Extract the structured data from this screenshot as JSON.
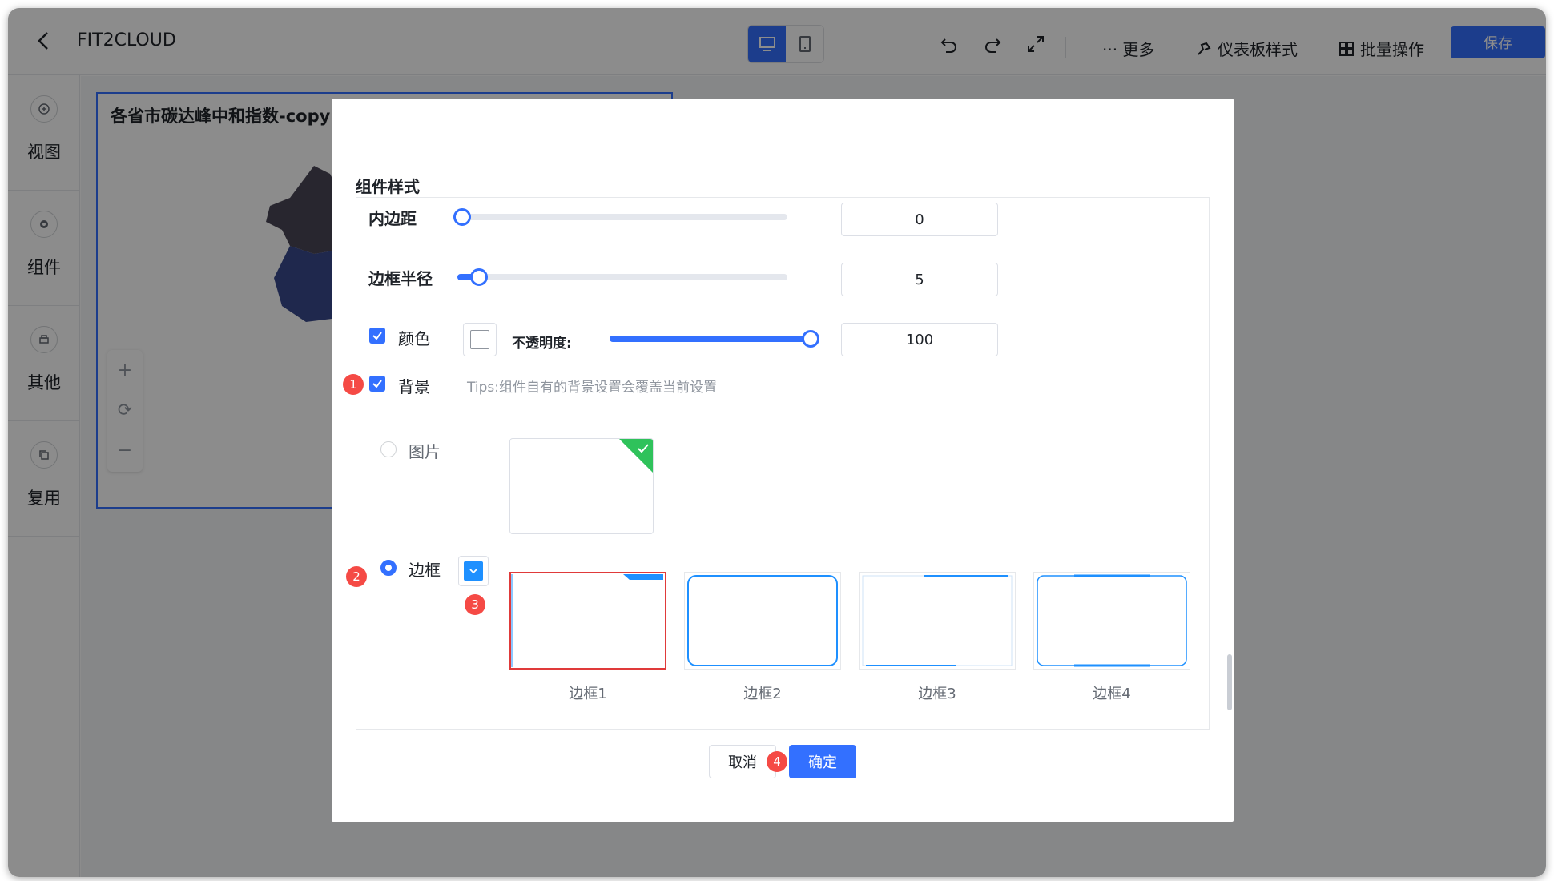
{
  "topbar": {
    "title": "FIT2CLOUD",
    "more_label": "··· 更多",
    "dashboard_style_label": "仪表板样式",
    "batch_label": "批量操作",
    "save_label": "保存"
  },
  "sidebar": {
    "items": [
      {
        "label": "视图",
        "icon": "plus-circle-icon"
      },
      {
        "label": "组件",
        "icon": "gear-icon"
      },
      {
        "label": "其他",
        "icon": "printer-icon"
      },
      {
        "label": "复用",
        "icon": "copy-icon"
      }
    ]
  },
  "chart": {
    "title": "各省市碳达峰中和指数-copy("
  },
  "dialog": {
    "section_title": "组件样式",
    "padding": {
      "label": "内边距",
      "value": "0",
      "level": 0
    },
    "radius": {
      "label": "边框半径",
      "value": "5",
      "level": 5
    },
    "color": {
      "label": "颜色",
      "checked": true,
      "opacity_label": "不透明度:",
      "opacity_value": "100",
      "level": 100
    },
    "background": {
      "label": "背景",
      "checked": true,
      "tips": "Tips:组件自有的背景设置会覆盖当前设置"
    },
    "image_option": {
      "label": "图片",
      "selected": false
    },
    "border_option": {
      "label": "边框",
      "selected": true
    },
    "borders": [
      {
        "caption": "边框1",
        "selected": true
      },
      {
        "caption": "边框2",
        "selected": false
      },
      {
        "caption": "边框3",
        "selected": false
      },
      {
        "caption": "边框4",
        "selected": false
      }
    ],
    "cancel_label": "取消",
    "ok_label": "确定"
  },
  "badges": [
    "1",
    "2",
    "3",
    "4"
  ],
  "colors": {
    "accent": "#3370ff",
    "badge": "#f54a45",
    "selected_border": "#e03a3a",
    "border_blue": "#1e90ff",
    "check_green": "#2fc25b"
  }
}
